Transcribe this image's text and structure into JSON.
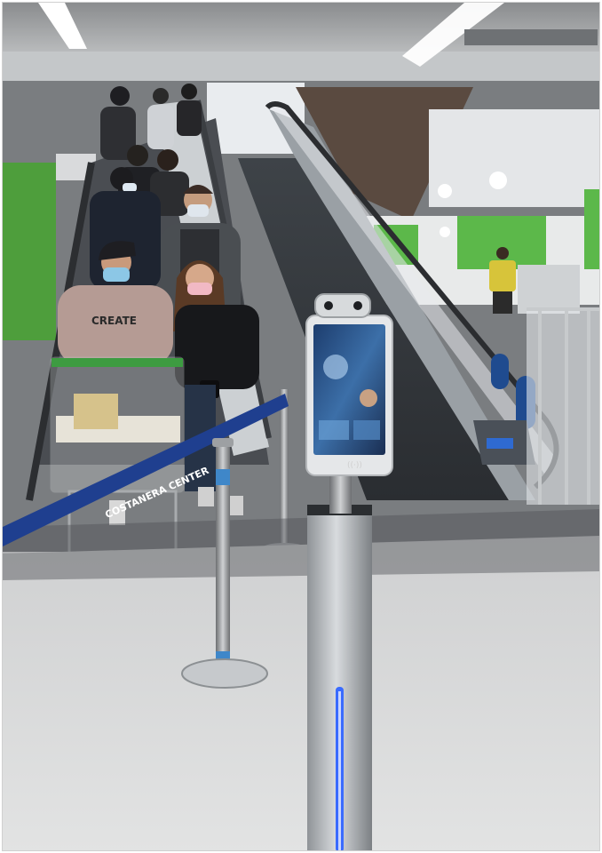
{
  "scene": {
    "belt_barrier_text": "COSTANERA CENTER",
    "hoodie_print_text": "CREATE",
    "kiosk_contactless_symbol": "((·))"
  },
  "colors": {
    "ceiling": "#cfd2d4",
    "wall_green": "#5cb84a",
    "floor": "#d9dadb",
    "belt_blue": "#1f3f8f",
    "kiosk_glow": "#3a6bff"
  },
  "icons": {
    "contactless": "nfc-icon"
  }
}
